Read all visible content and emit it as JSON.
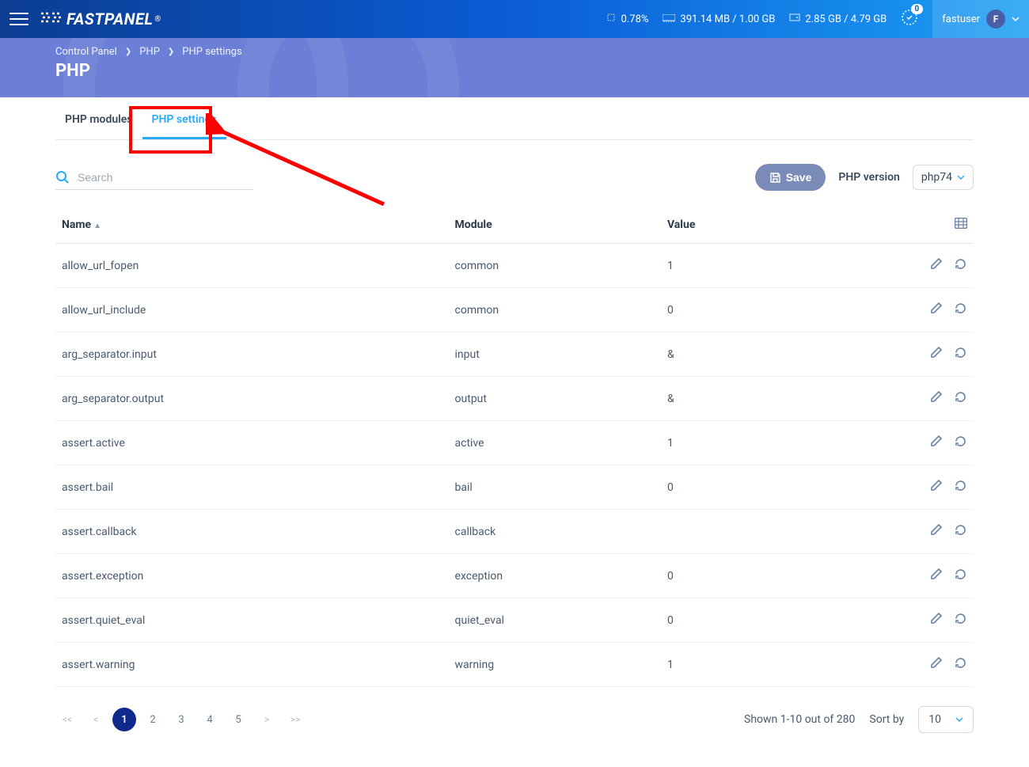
{
  "header": {
    "brand": "FASTPANEL",
    "cpu": "0.78%",
    "mem": "391.14 MB / 1.00 GB",
    "disk": "2.85 GB / 4.79 GB",
    "notif_count": "0",
    "username": "fastuser",
    "avatar_letter": "F"
  },
  "breadcrumb": {
    "a": "Control Panel",
    "b": "PHP",
    "c": "PHP settings"
  },
  "page_title": "PHP",
  "tabs": {
    "modules": "PHP modules",
    "settings": "PHP settings"
  },
  "toolbar": {
    "search_placeholder": "Search",
    "save": "Save",
    "version_label": "PHP version",
    "version_value": "php74"
  },
  "columns": {
    "name": "Name",
    "module": "Module",
    "value": "Value"
  },
  "rows": [
    {
      "name": "allow_url_fopen",
      "module": "common",
      "value": "1"
    },
    {
      "name": "allow_url_include",
      "module": "common",
      "value": "0"
    },
    {
      "name": "arg_separator.input",
      "module": "input",
      "value": "&"
    },
    {
      "name": "arg_separator.output",
      "module": "output",
      "value": "&"
    },
    {
      "name": "assert.active",
      "module": "active",
      "value": "1"
    },
    {
      "name": "assert.bail",
      "module": "bail",
      "value": "0"
    },
    {
      "name": "assert.callback",
      "module": "callback",
      "value": ""
    },
    {
      "name": "assert.exception",
      "module": "exception",
      "value": "0"
    },
    {
      "name": "assert.quiet_eval",
      "module": "quiet_eval",
      "value": "0"
    },
    {
      "name": "assert.warning",
      "module": "warning",
      "value": "1"
    }
  ],
  "pagination": {
    "pages": [
      "1",
      "2",
      "3",
      "4",
      "5"
    ],
    "first": "<<",
    "prev": "<",
    "next": ">",
    "last": ">>"
  },
  "footer": {
    "shown": "Shown 1-10 out of 280",
    "sort_label": "Sort by",
    "sort_value": "10"
  }
}
